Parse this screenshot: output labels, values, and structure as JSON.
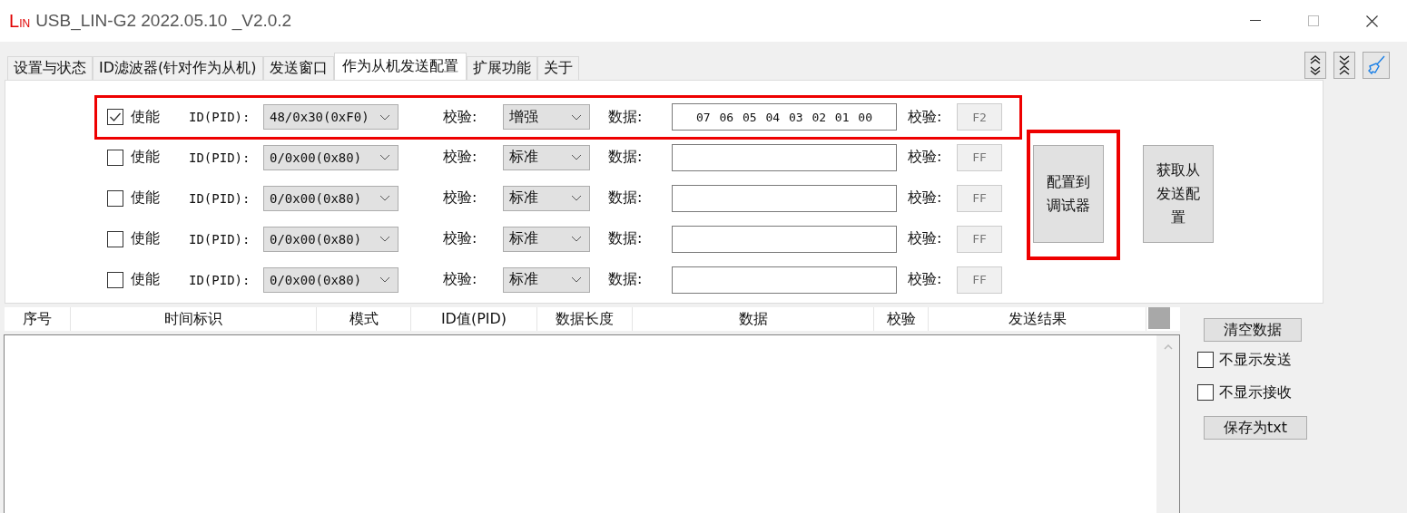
{
  "window": {
    "logo": {
      "big": "L",
      "small": "IN"
    },
    "title": "USB_LIN-G2 2022.05.10 _V2.0.2"
  },
  "tabs": [
    {
      "label": "设置与状态",
      "selected": false
    },
    {
      "label": "ID滤波器(针对作为从机)",
      "selected": false
    },
    {
      "label": "发送窗口",
      "selected": false
    },
    {
      "label": "作为从机发送配置",
      "selected": true
    },
    {
      "label": "扩展功能",
      "selected": false
    },
    {
      "label": "关于",
      "selected": false
    }
  ],
  "slave_rows": [
    {
      "enabled": true,
      "highlighted": true,
      "enable_label": "使能",
      "id_label": "ID(PID):",
      "id_value": "48/0x30(0xF0)",
      "check_label": "校验:",
      "check_type": "增强",
      "data_label": "数据:",
      "data": "07 06 05 04 03 02 01 00",
      "checksum_label": "校验:",
      "checksum": "F2"
    },
    {
      "enabled": false,
      "highlighted": false,
      "enable_label": "使能",
      "id_label": "ID(PID):",
      "id_value": "0/0x00(0x80)",
      "check_label": "校验:",
      "check_type": "标准",
      "data_label": "数据:",
      "checksum_label": "校验:",
      "checksum": "FF"
    },
    {
      "enabled": false,
      "highlighted": false,
      "enable_label": "使能",
      "id_label": "ID(PID):",
      "id_value": "0/0x00(0x80)",
      "check_label": "校验:",
      "check_type": "标准",
      "data_label": "数据:",
      "checksum_label": "校验:",
      "checksum": "FF"
    },
    {
      "enabled": false,
      "highlighted": false,
      "enable_label": "使能",
      "id_label": "ID(PID):",
      "id_value": "0/0x00(0x80)",
      "check_label": "校验:",
      "check_type": "标准",
      "data_label": "数据:",
      "checksum_label": "校验:",
      "checksum": "FF"
    },
    {
      "enabled": false,
      "highlighted": false,
      "enable_label": "使能",
      "id_label": "ID(PID):",
      "id_value": "0/0x00(0x80)",
      "check_label": "校验:",
      "check_type": "标准",
      "data_label": "数据:",
      "checksum_label": "校验:",
      "checksum": "FF"
    }
  ],
  "config_buttons": [
    {
      "label": "配置到调试器",
      "highlighted": true
    },
    {
      "label": "获取从发送配置",
      "highlighted": false
    }
  ],
  "table": {
    "columns": [
      "序号",
      "时间标识",
      "模式",
      "ID值(PID)",
      "数据长度",
      "数据",
      "校验",
      "发送结果"
    ]
  },
  "side": {
    "clear_button": "清空数据",
    "options": [
      {
        "label": "不显示发送",
        "checked": false
      },
      {
        "label": "不显示接收",
        "checked": false
      }
    ],
    "save_button": "保存为txt"
  }
}
